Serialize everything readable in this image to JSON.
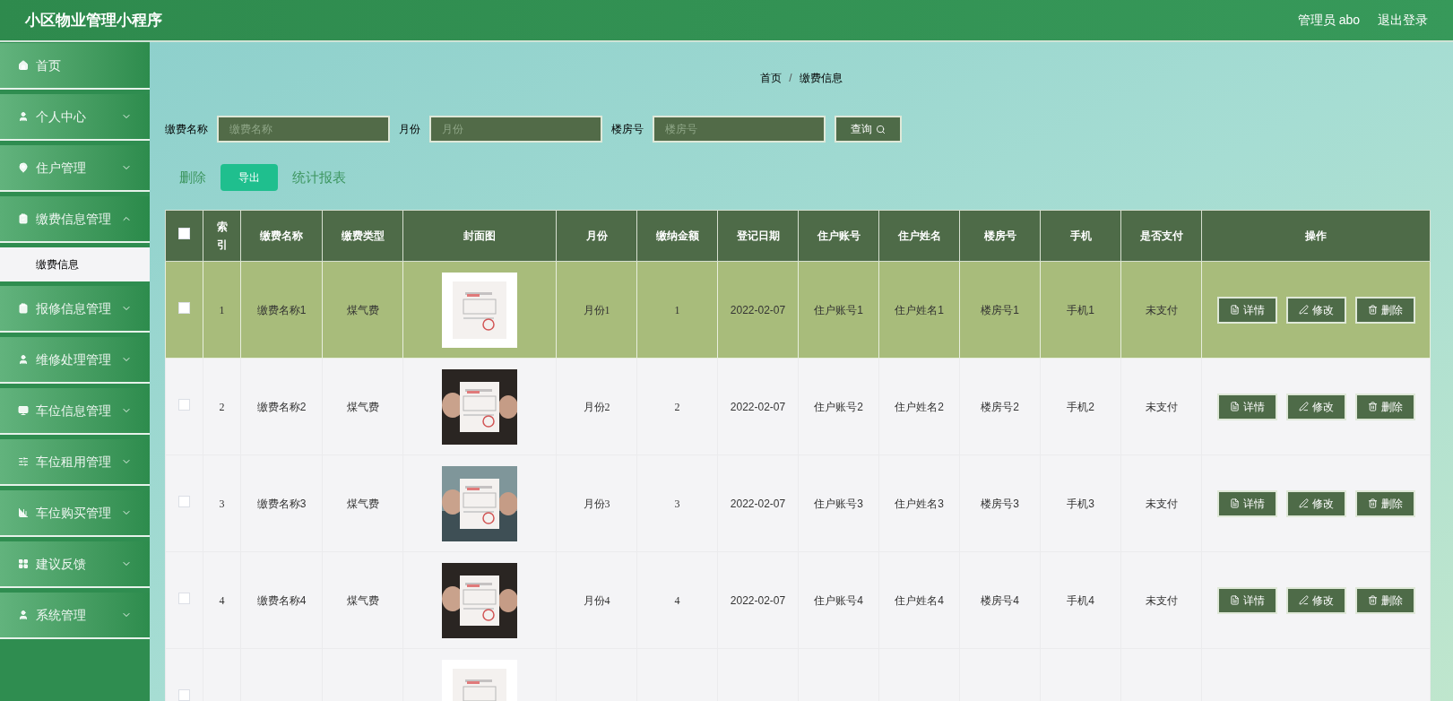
{
  "header": {
    "title": "小区物业管理小程序",
    "user": "管理员 abo",
    "logout": "退出登录"
  },
  "sidebar": {
    "items": [
      {
        "label": "首页",
        "has_arrow": false
      },
      {
        "label": "个人中心",
        "has_arrow": true,
        "expanded": false
      },
      {
        "label": "住户管理",
        "has_arrow": true,
        "expanded": false
      },
      {
        "label": "缴费信息管理",
        "has_arrow": true,
        "expanded": true,
        "children": [
          {
            "label": "缴费信息",
            "selected": true
          }
        ]
      },
      {
        "label": "报修信息管理",
        "has_arrow": true,
        "expanded": false
      },
      {
        "label": "维修处理管理",
        "has_arrow": true,
        "expanded": false
      },
      {
        "label": "车位信息管理",
        "has_arrow": true,
        "expanded": false
      },
      {
        "label": "车位租用管理",
        "has_arrow": true,
        "expanded": false
      },
      {
        "label": "车位购买管理",
        "has_arrow": true,
        "expanded": false
      },
      {
        "label": "建议反馈",
        "has_arrow": true,
        "expanded": false
      },
      {
        "label": "系统管理",
        "has_arrow": true,
        "expanded": false
      }
    ]
  },
  "breadcrumb": {
    "items": [
      "首页",
      "缴费信息"
    ],
    "separator": "/"
  },
  "search": {
    "fields": [
      {
        "label": "缴费名称",
        "placeholder": "缴费名称"
      },
      {
        "label": "月份",
        "placeholder": "月份"
      },
      {
        "label": "楼房号",
        "placeholder": "楼房号"
      }
    ],
    "button": "查询"
  },
  "actions": [
    {
      "label": "删除",
      "kind": "link"
    },
    {
      "label": "导出",
      "kind": "button"
    },
    {
      "label": "统计报表",
      "kind": "link"
    }
  ],
  "table": {
    "header_checked": false,
    "columns": [
      "索引",
      "缴费名称",
      "缴费类型",
      "封面图",
      "月份",
      "缴纳金额",
      "登记日期",
      "住户账号",
      "住户姓名",
      "楼房号",
      "手机",
      "是否支付",
      "操作"
    ],
    "rows": [
      {
        "selected": true,
        "checked": false,
        "cells": [
          "1",
          "缴费名称1",
          "煤气费",
          {
            "kind": "picture"
          },
          "月份1",
          "1",
          "2022-02-07",
          "住户账号1",
          "住户姓名1",
          "楼房号1",
          "手机1",
          "未支付"
        ],
        "buttons": [
          "详情",
          "修改",
          "删除"
        ]
      },
      {
        "selected": false,
        "checked": false,
        "cells": [
          "2",
          "缴费名称2",
          "煤气费",
          {
            "kind": "picture"
          },
          "月份2",
          "2",
          "2022-02-07",
          "住户账号2",
          "住户姓名2",
          "楼房号2",
          "手机2",
          "未支付"
        ],
        "buttons": [
          "详情",
          "修改",
          "删除"
        ]
      },
      {
        "selected": false,
        "checked": false,
        "cells": [
          "3",
          "缴费名称3",
          "煤气费",
          {
            "kind": "picture"
          },
          "月份3",
          "3",
          "2022-02-07",
          "住户账号3",
          "住户姓名3",
          "楼房号3",
          "手机3",
          "未支付"
        ],
        "buttons": [
          "详情",
          "修改",
          "删除"
        ]
      },
      {
        "selected": false,
        "checked": false,
        "cells": [
          "4",
          "缴费名称4",
          "煤气费",
          {
            "kind": "picture"
          },
          "月份4",
          "4",
          "2022-02-07",
          "住户账号4",
          "住户姓名4",
          "楼房号4",
          "手机4",
          "未支付"
        ],
        "buttons": [
          "详情",
          "修改",
          "删除"
        ]
      },
      {
        "selected": false,
        "checked": false,
        "cells": [],
        "buttons": []
      }
    ]
  }
}
